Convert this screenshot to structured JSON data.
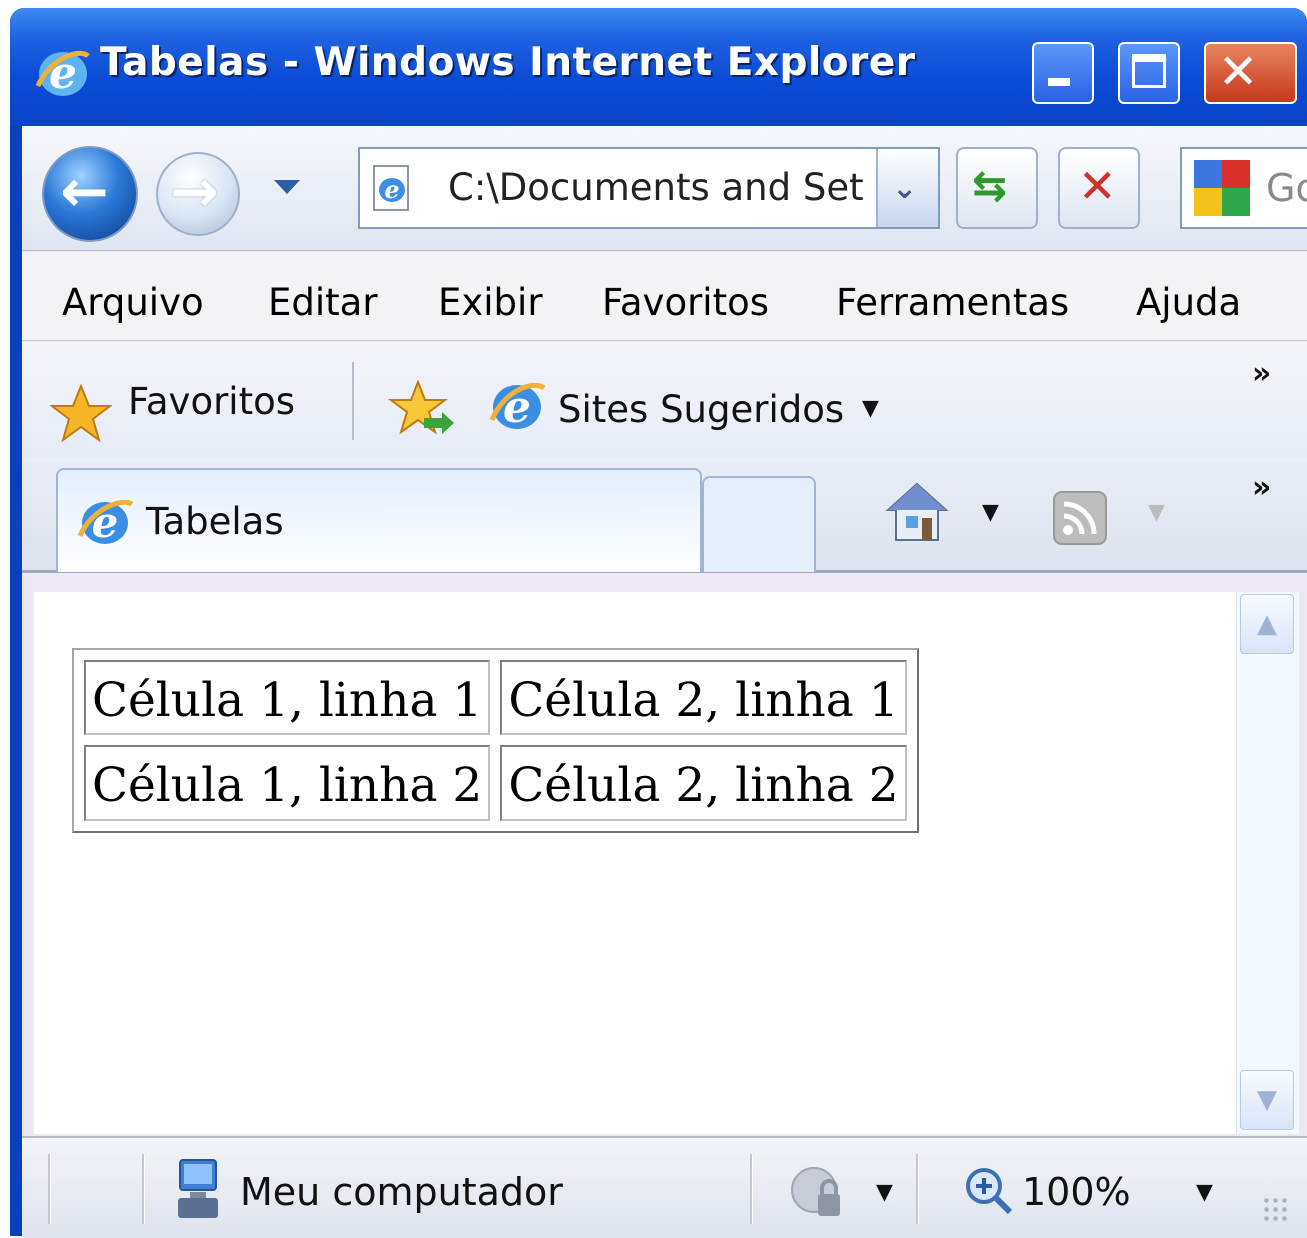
{
  "window": {
    "title": "Tabelas - Windows Internet Explorer"
  },
  "address_bar": {
    "value": "C:\\Documents and Set"
  },
  "search": {
    "placeholder": "Go"
  },
  "menu": [
    "Arquivo",
    "Editar",
    "Exibir",
    "Favoritos",
    "Ferramentas",
    "Ajuda"
  ],
  "favorites_bar": {
    "favorites_label": "Favoritos",
    "suggested_sites_label": "Sites Sugeridos",
    "overflow": "»"
  },
  "tabs": [
    {
      "label": "Tabelas",
      "active": true
    }
  ],
  "tab_overflow": "»",
  "table": {
    "rows": [
      [
        "Célula 1, linha 1",
        "Célula 2, linha 1"
      ],
      [
        "Célula 1, linha 2",
        "Célula 2, linha 2"
      ]
    ]
  },
  "status_bar": {
    "zone": "Meu computador",
    "zoom": "100%"
  },
  "colors": {
    "titlebar": "#0a44c7",
    "close_button": "#c4391b",
    "page_background": "#ffffff"
  },
  "icons": [
    "ie-logo-icon",
    "back-arrow-icon",
    "forward-arrow-icon",
    "refresh-icon",
    "stop-icon",
    "google-icon",
    "star-icon",
    "add-favorite-icon",
    "home-icon",
    "rss-feed-icon",
    "computer-icon",
    "protected-mode-icon",
    "zoom-icon"
  ]
}
